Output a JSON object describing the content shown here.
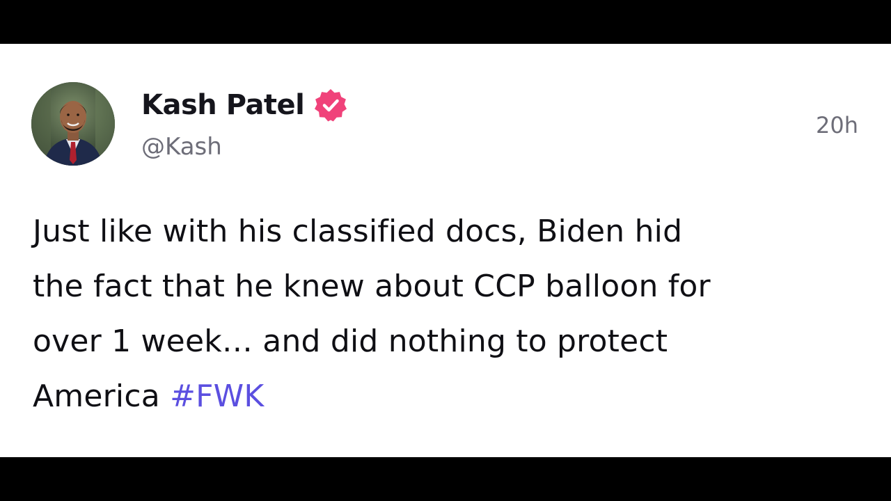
{
  "post": {
    "author": {
      "display_name": "Kash Patel",
      "handle": "@Kash",
      "verified_icon": "verified-badge-icon",
      "verified_color": "#f0427a"
    },
    "timestamp": "20h",
    "body_lines": [
      "Just like with his classified docs, Biden hid",
      "the fact that he knew about CCP balloon for",
      "over 1 week… and did nothing to protect",
      "America"
    ],
    "hashtag": "#FWK",
    "hashtag_color": "#5b4fe0"
  }
}
